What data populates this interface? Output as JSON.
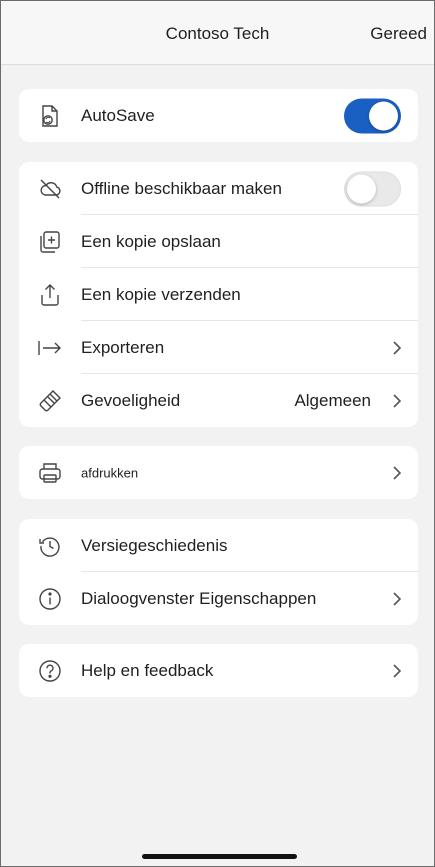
{
  "header": {
    "title": "Contoso Tech",
    "done_label": "Gereed"
  },
  "autosave": {
    "label": "AutoSave",
    "enabled": true,
    "icon": "autosave-file-icon"
  },
  "file_actions": {
    "offline": {
      "label": "Offline beschikbaar maken",
      "enabled": false,
      "icon": "cloud-off-icon"
    },
    "save_copy": {
      "label": "Een kopie opslaan",
      "icon": "add-copy-icon"
    },
    "send_copy": {
      "label": "Een kopie verzenden",
      "icon": "share-icon"
    },
    "export": {
      "label": "Exporteren",
      "icon": "export-arrow-icon"
    },
    "sensitivity": {
      "label": "Gevoeligheid",
      "value": "Algemeen",
      "icon": "sensitivity-brush-icon"
    }
  },
  "print": {
    "label": "afdrukken",
    "icon": "printer-icon"
  },
  "info": {
    "version_history": {
      "label": "Versiegeschiedenis",
      "icon": "history-icon"
    },
    "properties": {
      "label": "Dialoogvenster Eigenschappen",
      "icon": "info-icon"
    }
  },
  "help": {
    "label": "Help en feedback",
    "icon": "help-icon"
  },
  "colors": {
    "accent": "#1a5fc2",
    "background": "#f2f2f2",
    "card": "#ffffff"
  }
}
